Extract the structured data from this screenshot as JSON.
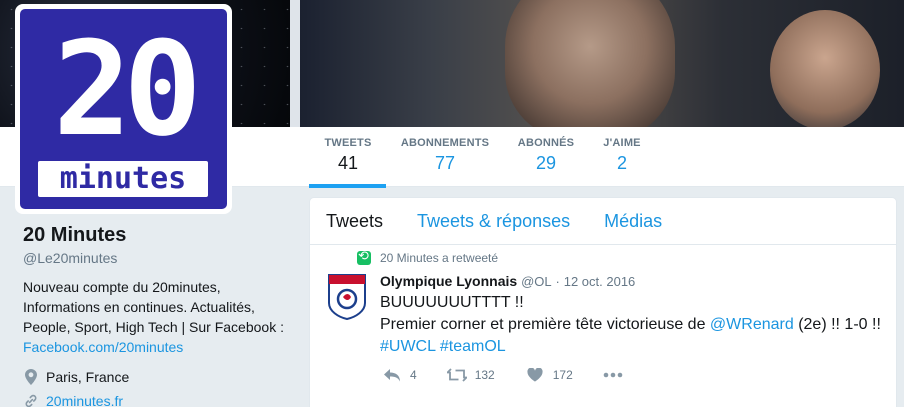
{
  "profile": {
    "avatar_top": "20",
    "avatar_bottom": "minutes",
    "name": "20 Minutes",
    "handle": "@Le20minutes",
    "bio": "Nouveau compte du 20minutes, Informations en continues. Actualités, People, Sport, High Tech | Sur Facebook : ",
    "bio_link": "Facebook.com/20minutes",
    "location": "Paris, France",
    "website": "20minutes.fr"
  },
  "stats": [
    {
      "label": "TWEETS",
      "value": "41"
    },
    {
      "label": "ABONNEMENTS",
      "value": "77"
    },
    {
      "label": "ABONNÉS",
      "value": "29"
    },
    {
      "label": "J'AIME",
      "value": "2"
    }
  ],
  "tabs": [
    "Tweets",
    "Tweets & réponses",
    "Médias"
  ],
  "tweet": {
    "retweet_label": "20 Minutes a retweeté",
    "author": "Olympique Lyonnais",
    "handle": "@OL",
    "sep": "·",
    "date": "12 oct. 2016",
    "line1": "BUUUUUUUTTTT !!",
    "line2_pre": "Premier corner et première tête victorieuse de ",
    "mention": "@WRenard",
    "line2_post": " (2e) !! 1-0 !!",
    "hashtag1": "#UWCL",
    "hashtag2": "#teamOL",
    "avatar_text": "OLYMPIQUE LYONNAIS",
    "replies": "4",
    "retweets": "132",
    "likes": "172"
  },
  "colors": {
    "accent": "#1da1f2",
    "link": "#1b95e0",
    "retweet": "#17bf63",
    "avatar_bg": "#2f2aa4"
  },
  "icons": [
    "location-icon",
    "link-icon",
    "retweet-icon",
    "reply-icon",
    "like-icon",
    "more-icon"
  ]
}
